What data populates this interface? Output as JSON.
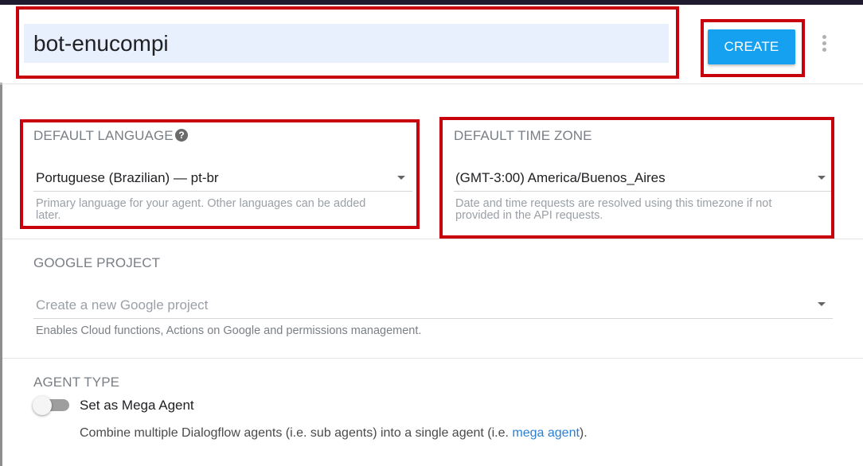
{
  "agent": {
    "name_value": "bot-enucompi",
    "create_label": "CREATE"
  },
  "language": {
    "label": "DEFAULT LANGUAGE",
    "value": "Portuguese (Brazilian) — pt-br",
    "hint_line1": "Primary language for your agent. Other languages can be added",
    "hint_line2": "later."
  },
  "timezone": {
    "label": "DEFAULT TIME ZONE",
    "value": "(GMT-3:00) America/Buenos_Aires",
    "hint_line1": "Date and time requests are resolved using this timezone if not",
    "hint_line2": "provided in the API requests."
  },
  "google_project": {
    "label": "GOOGLE PROJECT",
    "placeholder": "Create a new Google project",
    "hint": "Enables Cloud functions, Actions on Google and permissions management."
  },
  "agent_type": {
    "label": "AGENT TYPE",
    "toggle_label": "Set as Mega Agent",
    "toggle_on": false,
    "description_prefix": "Combine multiple Dialogflow agents (i.e. sub agents) into a single agent (i.e. ",
    "description_link": "mega agent",
    "description_suffix": ")."
  },
  "icons": {
    "help": "help-circle-icon",
    "menu": "more-vert-icon",
    "dropdown": "caret-down-icon"
  },
  "colors": {
    "accent": "#15a0f0",
    "highlight_box": "#c8000c",
    "input_bg": "#e8f0fe",
    "link": "#2a7fd4"
  }
}
